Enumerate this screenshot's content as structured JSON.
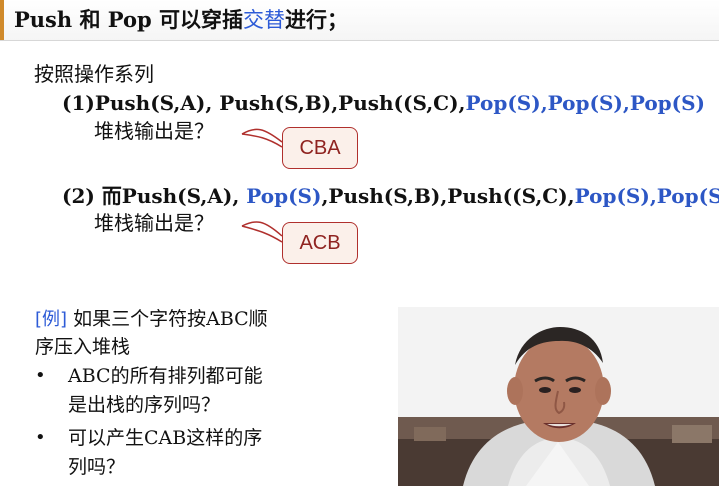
{
  "slide": {
    "title_parts": {
      "pre": "Push 和 Pop 可以穿插",
      "hl": "交替",
      "post": "进行；"
    },
    "intro": "按照操作系列",
    "example1": {
      "prefix": "(1)Push(S,A), Push(S,B),Push((S,C),",
      "blue": "Pop(S),Pop(S),Pop(S)"
    },
    "question1": "堆栈输出是？",
    "answer1": "CBA",
    "example2": {
      "prefix": "(2) 而Push(S,A), ",
      "blue1": "Pop(S)",
      "middle": ",Push(S,B),Push((S,C),",
      "blue2": "Pop(S),Pop(S)"
    },
    "question2": "堆栈输出是？",
    "answer2": "ACB",
    "example_tag": "[例]",
    "example_line1": "如果三个字符按ABC顺",
    "example_line2": "序压入堆栈",
    "bullet_char": "•",
    "bullet1_line1": "ABC的所有排列都可能",
    "bullet1_line2": "是出栈的序列吗？",
    "bullet2_line1": "可以产生CAB这样的序",
    "bullet2_line2": "列吗？"
  },
  "colors": {
    "accent": "#d08a2b",
    "highlight_blue": "#2d5bd7",
    "answer_border": "#b0302d",
    "answer_fill": "#fbf0ea",
    "answer_text": "#8f2320"
  }
}
